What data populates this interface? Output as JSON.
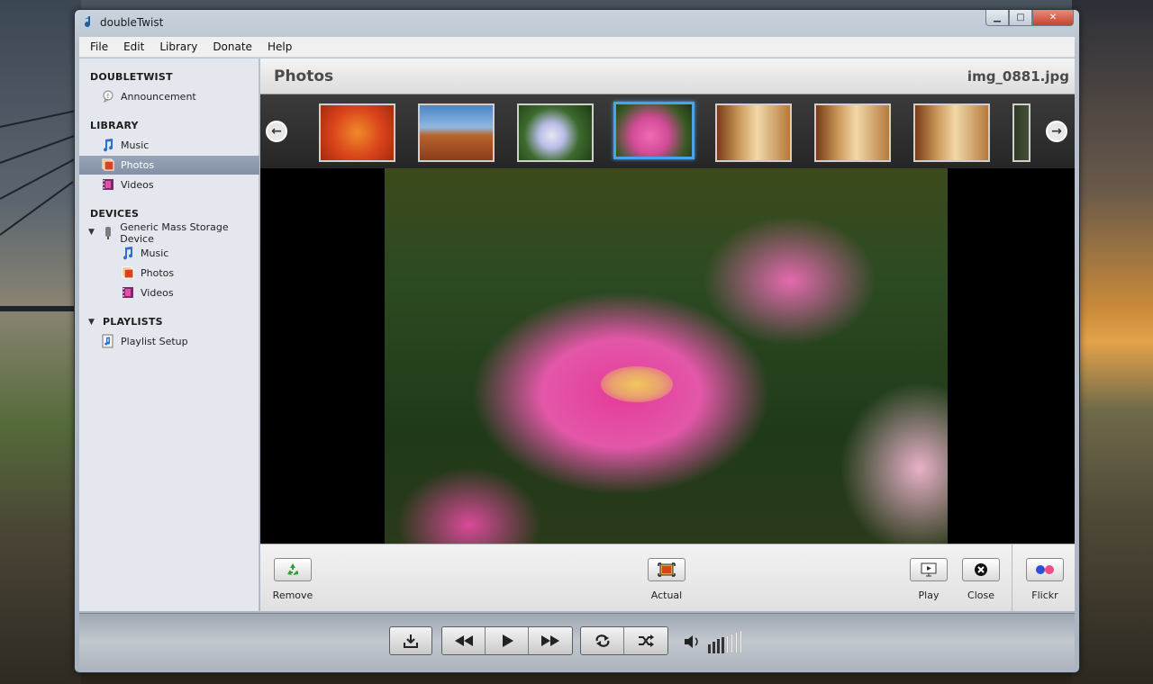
{
  "window": {
    "title": "doubleTwist"
  },
  "window_controls": {
    "minimize": "▁",
    "maximize": "□",
    "close": "✕"
  },
  "menu": [
    "File",
    "Edit",
    "Library",
    "Donate",
    "Help"
  ],
  "sidebar": {
    "sections": {
      "doubletwist": {
        "header": "DOUBLETWIST",
        "items": [
          "Announcement"
        ]
      },
      "library": {
        "header": "LIBRARY",
        "items": [
          "Music",
          "Photos",
          "Videos"
        ],
        "selected": "Photos"
      },
      "devices": {
        "header": "DEVICES",
        "device": "Generic Mass Storage Device",
        "items": [
          "Music",
          "Photos",
          "Videos"
        ]
      },
      "playlists": {
        "header": "PLAYLISTS",
        "items": [
          "Playlist Setup"
        ]
      }
    }
  },
  "main": {
    "title": "Photos",
    "file_name": "img_0881.jpg"
  },
  "strip": {
    "thumbnails": [
      {
        "name": "red-chrysanthemum",
        "color": "#d9431b"
      },
      {
        "name": "desert-butte",
        "color": "#a8552c"
      },
      {
        "name": "white-hydrangea",
        "color": "#3d6a2e"
      },
      {
        "name": "pink-dahlia",
        "color": "#c5508f",
        "selected": true
      },
      {
        "name": "kitchen-1",
        "color": "#b47a3c"
      },
      {
        "name": "kitchen-2",
        "color": "#b47a3c"
      },
      {
        "name": "kitchen-3",
        "color": "#b47a3c"
      }
    ]
  },
  "toolbar": {
    "remove_label": "Remove",
    "actual_label": "Actual",
    "play_label": "Play",
    "close_label": "Close",
    "flickr_label": "Flickr"
  },
  "volume": {
    "level": 0.4
  }
}
